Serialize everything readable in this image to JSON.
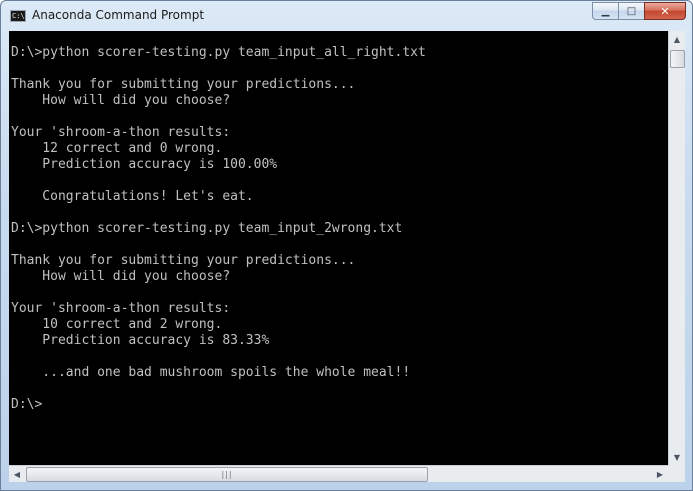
{
  "window": {
    "title": "Anaconda Command Prompt",
    "icon": "cmd-app-icon",
    "icon_glyph": "C:\\",
    "controls": {
      "minimize_glyph": "▁",
      "maximize_glyph": "□",
      "close_glyph": "✕"
    }
  },
  "console": {
    "foreground_color": "#c0c0c0",
    "background_color": "#000000",
    "lines": [
      "D:\\>python scorer-testing.py team_input_all_right.txt",
      "",
      "Thank you for submitting your predictions...",
      "    How will did you choose?",
      "",
      "Your 'shroom-a-thon results:",
      "    12 correct and 0 wrong.",
      "    Prediction accuracy is 100.00%",
      "",
      "    Congratulations! Let's eat.",
      "",
      "D:\\>python scorer-testing.py team_input_2wrong.txt",
      "",
      "Thank you for submitting your predictions...",
      "    How will did you choose?",
      "",
      "Your 'shroom-a-thon results:",
      "    10 correct and 2 wrong.",
      "    Prediction accuracy is 83.33%",
      "",
      "    ...and one bad mushroom spoils the whole meal!!",
      "",
      "D:\\>"
    ]
  },
  "scrollbars": {
    "up_arrow": "▲",
    "down_arrow": "▼",
    "left_arrow": "◀",
    "right_arrow": "▶",
    "h_thumb_grip": "|||"
  }
}
